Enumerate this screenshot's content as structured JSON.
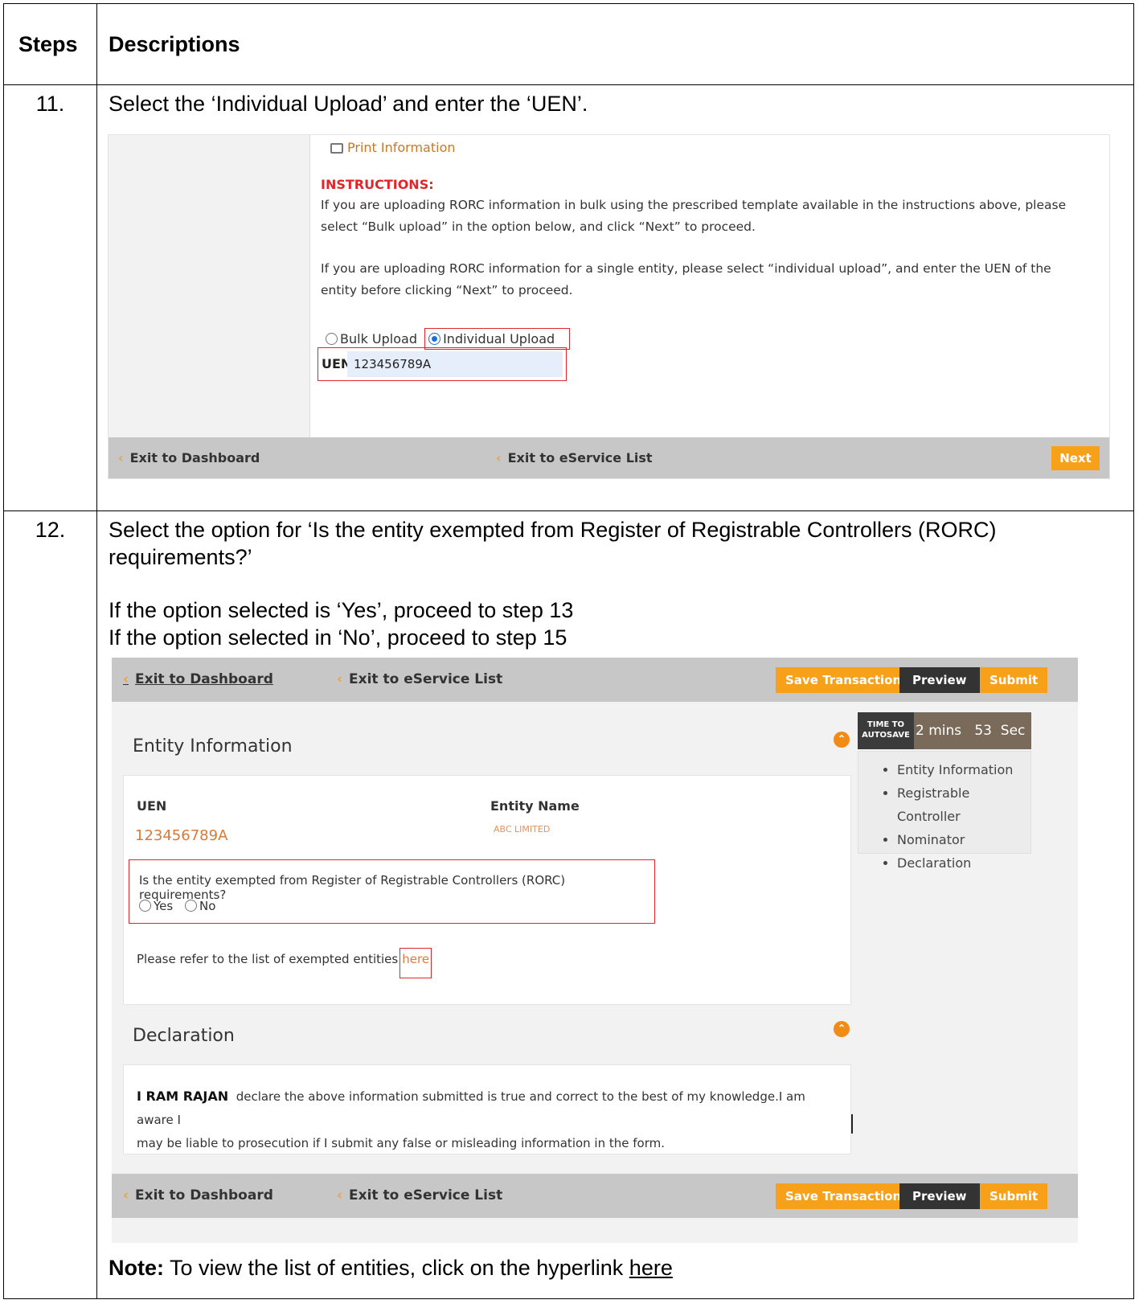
{
  "table": {
    "header_steps": "Steps",
    "header_desc": "Descriptions"
  },
  "step11": {
    "number": "11.",
    "text": "Select the ‘Individual Upload’ and enter the ‘UEN’.",
    "screen": {
      "print_label": "Print Information",
      "instructions_heading": "INSTRUCTIONS:",
      "para1_line1": "If you are uploading RORC information in bulk using the prescribed template available in the instructions above, please",
      "para1_line2": "select “Bulk upload” in the option below, and click “Next” to proceed.",
      "para2_line1": "If you are uploading RORC information for a single entity, please select “individual upload”, and enter the UEN of the",
      "para2_line2": "entity before clicking “Next” to proceed.",
      "opt_bulk": "Bulk Upload",
      "opt_individual": "Individual Upload",
      "uen_label": "UEN",
      "uen_value": "123456789A",
      "exit_dashboard": "Exit to Dashboard",
      "exit_eservice": "Exit to eService List",
      "next_label": "Next"
    }
  },
  "step12": {
    "number": "12.",
    "text_line1": "Select the option for ‘Is the entity exempted from Register of Registrable Controllers (RORC)",
    "text_line2": "requirements?’",
    "yes_line": "If the option selected is ‘Yes’, proceed to step 13",
    "no_line": "If the option selected in ‘No’, proceed to step 15",
    "screen": {
      "exit_dashboard": "Exit to Dashboard",
      "exit_eservice": "Exit to eService List",
      "save_label": "Save Transaction",
      "preview_label": "Preview",
      "submit_label": "Submit",
      "entity_section": "Entity Information",
      "uen_label": "UEN",
      "uen_value": "123456789A",
      "entity_name_label": "Entity Name",
      "entity_name_value": "ABC LIMITED",
      "question": "Is the entity exempted from Register of Registrable Controllers (RORC) requirements?",
      "opt_yes": "Yes",
      "opt_no": "No",
      "refer_text": "Please refer to the list of exempted entities",
      "refer_link": "here",
      "declaration_section": "Declaration",
      "declarant": "I RAM RAJAN",
      "declaration_line1": "declare the above information submitted is true and correct to the best of my knowledge.I am aware I",
      "declaration_line2": "may be liable to prosecution if I submit any false or misleading information in the form.",
      "timer_label_1": "TIME TO",
      "timer_label_2": "AUTOSAVE",
      "timer_value": "2 mins   53  Sec",
      "toc": [
        "Entity Information",
        "Registrable Controller",
        "Nominator",
        "Declaration"
      ]
    },
    "note_bold": "Note:",
    "note_text": "To view the list of entities, click on the hyperlink",
    "note_link": "here"
  },
  "colors": {
    "accent_orange": "#f7a01a",
    "highlight_red": "#e0262b",
    "bar_gray": "#c7c7c7"
  }
}
